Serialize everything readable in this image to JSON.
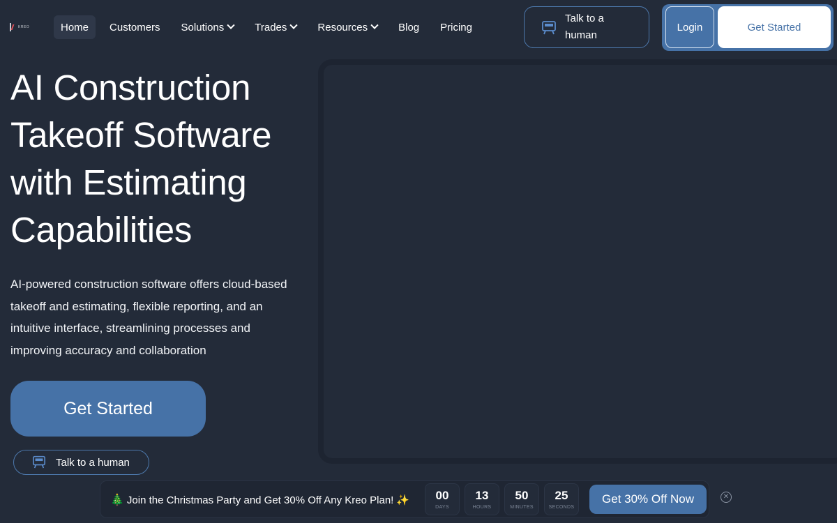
{
  "brand": {
    "logo_text": "kreo"
  },
  "nav": {
    "items": [
      {
        "label": "Home",
        "active": true,
        "dropdown": false
      },
      {
        "label": "Customers",
        "active": false,
        "dropdown": false
      },
      {
        "label": "Solutions",
        "active": false,
        "dropdown": true
      },
      {
        "label": "Trades",
        "active": false,
        "dropdown": true
      },
      {
        "label": "Resources",
        "active": false,
        "dropdown": true
      },
      {
        "label": "Blog",
        "active": false,
        "dropdown": false
      },
      {
        "label": "Pricing",
        "active": false,
        "dropdown": false
      }
    ],
    "talk_label": "Talk to a human",
    "talk_icon": "presentation-board-icon",
    "login_label": "Login",
    "get_started_label": "Get Started"
  },
  "hero": {
    "title": "AI Construction Takeoff Software with Estimating Capabilities",
    "description": "AI-powered construction software offers cloud-based takeoff and estimating, flexible reporting, and an intuitive interface, streamlining processes and improving accuracy and collaboration",
    "cta_label": "Get Started",
    "talk_label": "Talk to a human"
  },
  "promo": {
    "text": "Join the Christmas Party and Get 30% Off Any Kreo Plan!",
    "countdown": [
      {
        "value": "00",
        "unit": "DAYS"
      },
      {
        "value": "13",
        "unit": "HOURS"
      },
      {
        "value": "50",
        "unit": "MINUTES"
      },
      {
        "value": "25",
        "unit": "SECONDS"
      }
    ],
    "cta_label": "Get 30% Off Now"
  },
  "colors": {
    "background": "#232b39",
    "accent": "#4672a7",
    "outline": "#4d79ad"
  }
}
